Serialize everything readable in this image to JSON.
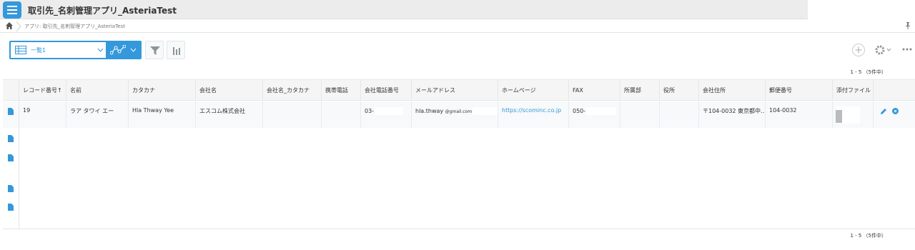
{
  "app": {
    "title": "取引先_名刺管理アプリ_AsteriaTest",
    "breadcrumb": "アプリ: 取引先_名刺管理アプリ_AsteriaTest"
  },
  "toolbar": {
    "view_label": "一覧1",
    "icons": [
      "list-view-icon",
      "graph-icon",
      "filter-icon",
      "chart-icon",
      "add-icon",
      "gear-icon",
      "more-icon"
    ]
  },
  "pager": {
    "top": "1 - 5 （5件中）",
    "bottom": "1 - 5 （5件中）"
  },
  "table": {
    "columns": [
      "レコード番号↑",
      "名前",
      "カタカナ",
      "会社名",
      "会社名_カタカナ",
      "携帯電話",
      "会社電話番号",
      "メールアドレス",
      "ホームページ",
      "FAX",
      "所属部",
      "役所",
      "会社住所",
      "郵便番号",
      "添付ファイル"
    ],
    "rows": [
      {
        "record_no": "19",
        "name": "ラア タワイ エー",
        "kana": "Hla Thway Yee",
        "company": "エスコム株式会社",
        "company_kana": "",
        "mobile": "",
        "company_phone": "03-",
        "email_user": "hla.thway",
        "email_domain": "@gmail.com",
        "homepage": "https://scominc.co.jp",
        "fax": "050-",
        "department": "",
        "position": "",
        "address": "〒104-0032 東京都中…",
        "postal_code": "104-0032"
      }
    ]
  },
  "colors": {
    "accent": "#3498db",
    "header_bg": "#f5f5f5",
    "link": "#3498db"
  }
}
